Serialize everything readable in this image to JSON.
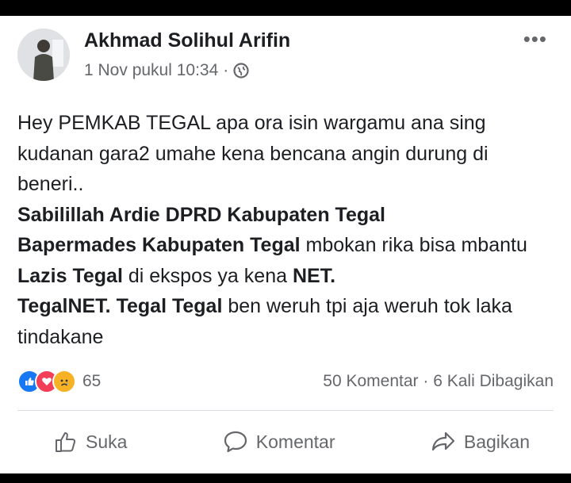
{
  "post": {
    "author": "Akhmad Solihul Arifin",
    "timestamp": "1 Nov pukul 10:34",
    "separator": "·",
    "more_icon": "ellipsis-icon",
    "privacy_icon": "globe-icon",
    "text": {
      "p1": "Hey PEMKAB TEGAL apa ora isin wargamu ana sing kudanan gara2 umahe kena bencana angin durung di beneri..",
      "tag1": "Sabilillah Ardie",
      "tag2": "DPRD Kabupaten Tegal",
      "tag3": "Bapermades Kabupaten Tegal",
      "t4": "mbokan rika bisa mbantu",
      "tag4": "Lazis Tegal",
      "t5": "di ekspos ya kena",
      "tag5": "NET.",
      "tag6": "TegalNET.",
      "tag7": "Tegal Tegal",
      "t6": "ben weruh tpi aja weruh tok laka tindakane"
    }
  },
  "stats": {
    "reactions": [
      "like",
      "love",
      "sad"
    ],
    "reaction_count": "65",
    "comments": "50 Komentar",
    "dot": "·",
    "shares": "6 Kali Dibagikan"
  },
  "actions": {
    "like": "Suka",
    "comment": "Komentar",
    "share": "Bagikan"
  },
  "colors": {
    "like": "#1877f2",
    "love": "#f33e58",
    "sad": "#f7b125"
  }
}
